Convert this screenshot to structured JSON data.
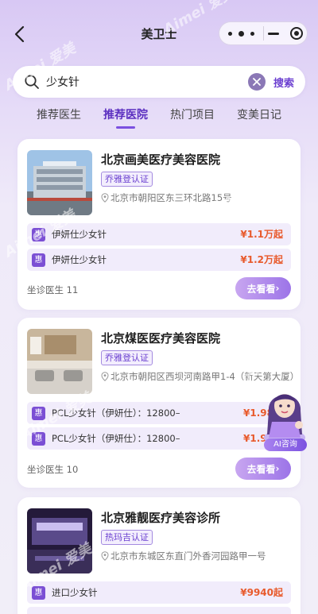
{
  "nav": {
    "title": "美卫士"
  },
  "search": {
    "query": "少女针",
    "button": "搜索"
  },
  "tabs": [
    {
      "label": "推荐医生",
      "active": false
    },
    {
      "label": "推荐医院",
      "active": true
    },
    {
      "label": "热门项目",
      "active": false
    },
    {
      "label": "变美日记",
      "active": false
    }
  ],
  "cards": [
    {
      "name": "北京画美医疗美容医院",
      "badge": "乔雅登认证",
      "address": "北京市朝阳区东三环北路15号",
      "promos": [
        {
          "tag": "惠",
          "text": "伊妍仕少女针",
          "price": "¥1.1万起"
        },
        {
          "tag": "惠",
          "text": "伊妍仕少女针",
          "price": "¥1.2万起"
        }
      ],
      "doctors": "坐诊医生 11",
      "cta": "去看看"
    },
    {
      "name": "北京煤医医疗美容医院",
      "badge": "乔雅登认证",
      "address": "北京市朝阳区西坝河南路甲1-4（新天第大厦）",
      "promos": [
        {
          "tag": "惠",
          "text": "PCL少女针（伊妍仕）：12800–",
          "price": "¥1.98万"
        },
        {
          "tag": "惠",
          "text": "PCL少女针（伊妍仕）：12800–",
          "price": "¥1.98万"
        }
      ],
      "doctors": "坐诊医生 10",
      "cta": "去看看"
    },
    {
      "name": "北京雅靓医疗美容诊所",
      "badge": "热玛吉认证",
      "address": "北京市东城区东直门外香河园路甲一号",
      "promos": [
        {
          "tag": "惠",
          "text": "进口少女针",
          "price": "¥9940起"
        }
      ]
    }
  ],
  "ai_assistant": {
    "label": "AI咨询"
  },
  "watermark": "Aimei 爱美",
  "colors": {
    "accent": "#7b4fe0",
    "price": "#e85a2c",
    "badge_border": "#a48be0"
  }
}
